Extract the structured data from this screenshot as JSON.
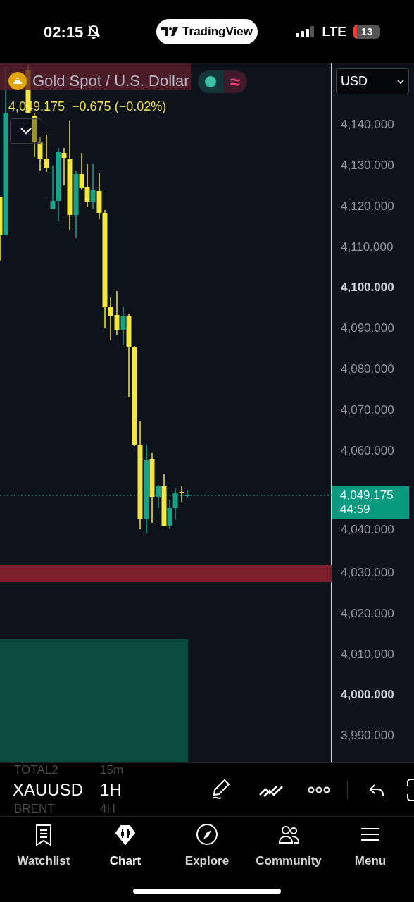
{
  "status_bar": {
    "time": "02:15",
    "app_pill": "TradingView",
    "network": "LTE",
    "battery": "13"
  },
  "symbol_header": {
    "title": "Gold Spot / U.S. Dollar",
    "indicator_glyph": "≈",
    "quote": "4,049.175  −0.675 (−0.02%)"
  },
  "price_scale": {
    "currency": "USD",
    "labels": [
      {
        "text": "4,140.000",
        "bold": false
      },
      {
        "text": "4,130.000",
        "bold": false
      },
      {
        "text": "4,120.000",
        "bold": false
      },
      {
        "text": "4,110.000",
        "bold": false
      },
      {
        "text": "4,100.000",
        "bold": true
      },
      {
        "text": "4,090.000",
        "bold": false
      },
      {
        "text": "4,080.000",
        "bold": false
      },
      {
        "text": "4,070.000",
        "bold": false
      },
      {
        "text": "4,060.000",
        "bold": false
      },
      {
        "text": "4,040.000",
        "bold": false
      },
      {
        "text": "4,030.000",
        "bold": false
      },
      {
        "text": "4,020.000",
        "bold": false
      },
      {
        "text": "4,010.000",
        "bold": false
      },
      {
        "text": "4,000.000",
        "bold": true
      },
      {
        "text": "3,990.000",
        "bold": false
      }
    ],
    "last_price": "4,049.175",
    "countdown": "44:59"
  },
  "toolbar": {
    "symbol": "XAUUSD",
    "interval": "1H",
    "ghost_rows": [
      {
        "symbol": "TOTAL2",
        "interval": "15m"
      },
      {
        "symbol": "BRENT",
        "interval": "4H"
      }
    ]
  },
  "nav": [
    {
      "label": "Watchlist",
      "selected": false
    },
    {
      "label": "Chart",
      "selected": true
    },
    {
      "label": "Explore",
      "selected": false
    },
    {
      "label": "Community",
      "selected": false
    },
    {
      "label": "Menu",
      "selected": false
    }
  ]
}
